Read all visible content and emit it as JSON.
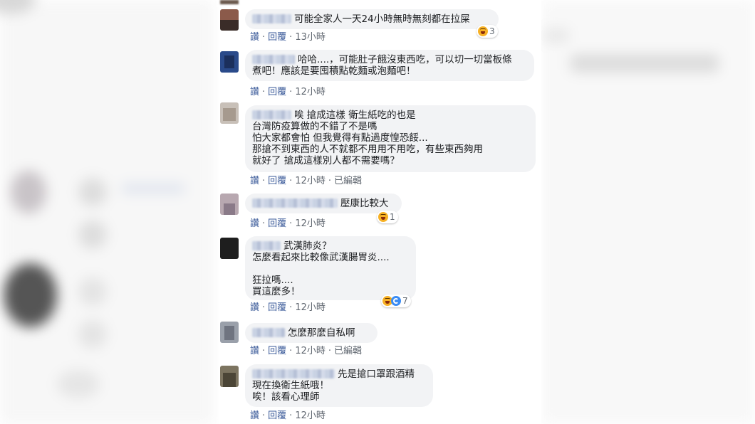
{
  "actions": {
    "like": "讚",
    "reply": "回覆",
    "edited": "已編輯",
    "dot": "·"
  },
  "comments": [
    {
      "lines": [
        "可能全家人一天24小時無時無刻都在拉屎"
      ],
      "time": "13小時",
      "edited": false,
      "reactions": {
        "types": [
          "haha"
        ],
        "count": "3"
      }
    },
    {
      "lines": [
        "哈哈....，可能肚子餓沒東西吃，可以切一切當板條",
        "煮吧！應該是要囤積點乾麵或泡麵吧！"
      ],
      "time": "12小時",
      "edited": false,
      "reactions": null
    },
    {
      "lines": [
        "唉 搶成這樣 衛生紙吃的也是",
        "台灣防疫算做的不錯了不是嗎",
        "怕大家都會怕 但我覺得有點過度惶恐餒...",
        "那搶不到東西的人不就都不用用不用吃，有些東西夠用",
        "就好了 搶成這樣別人都不需要嗎？"
      ],
      "time": "12小時",
      "edited": true,
      "reactions": null
    },
    {
      "lines": [
        "壓康比較大"
      ],
      "time": "12小時",
      "edited": false,
      "reactions": {
        "types": [
          "haha"
        ],
        "count": "1"
      }
    },
    {
      "lines": [
        "武漢肺炎？",
        "怎麼看起來比較像武漢腸胃炎....",
        "",
        "狂拉嗎....",
        "買這麼多！"
      ],
      "time": "12小時",
      "edited": false,
      "reactions": {
        "types": [
          "haha",
          "wow"
        ],
        "count": "7"
      }
    },
    {
      "lines": [
        "怎麼那麼自私啊"
      ],
      "time": "12小時",
      "edited": true,
      "reactions": null
    },
    {
      "lines": [
        "先是搶口罩跟酒精",
        "現在換衛生紙哦！",
        "唉！該看心理師"
      ],
      "time": "12小時",
      "edited": false,
      "reactions": null
    }
  ]
}
